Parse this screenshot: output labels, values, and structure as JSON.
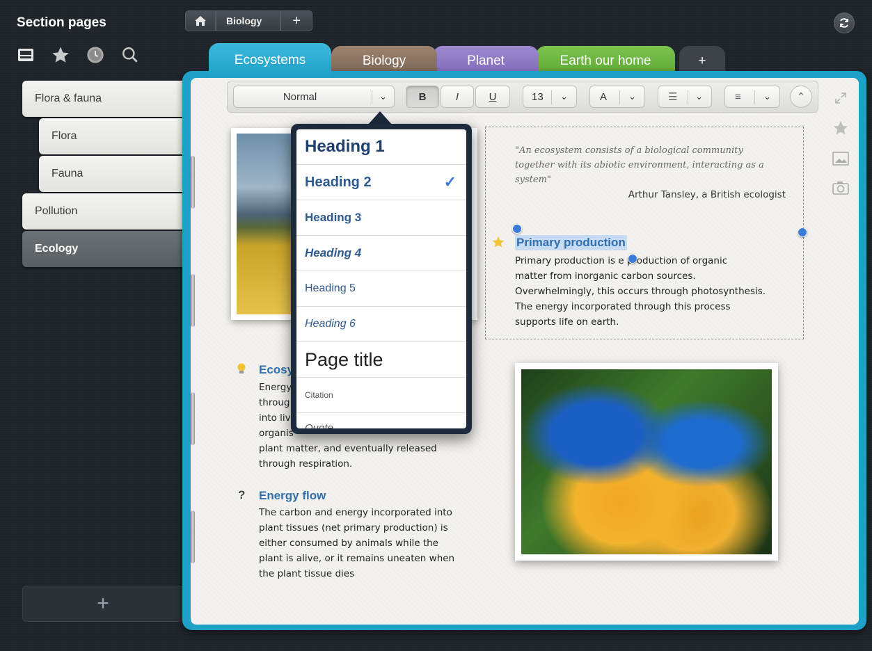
{
  "sidebar": {
    "title": "Section pages",
    "items": [
      {
        "label": "Flora & fauna"
      },
      {
        "label": "Flora"
      },
      {
        "label": "Fauna"
      },
      {
        "label": "Pollution"
      },
      {
        "label": "Ecology"
      }
    ],
    "add_label": "+"
  },
  "breadcrumb": {
    "items": [
      "Biology"
    ],
    "add_label": "+"
  },
  "tabs": [
    {
      "label": "Ecosystems",
      "color": "#2aa7cf"
    },
    {
      "label": "Biology",
      "color": "#8c7461"
    },
    {
      "label": "Planet",
      "color": "#8e78c4"
    },
    {
      "label": "Earth our home",
      "color": "#6ab43c"
    },
    {
      "label": "+",
      "color": "#4a4f55"
    }
  ],
  "toolbar": {
    "style_value": "Normal",
    "bold_label": "B",
    "italic_label": "I",
    "underline_label": "U",
    "font_size": "13",
    "font_label": "A"
  },
  "style_menu": {
    "items": [
      {
        "label": "Heading 1"
      },
      {
        "label": "Heading 2",
        "selected": true,
        "check": "✓"
      },
      {
        "label": "Heading 3"
      },
      {
        "label": "Heading 4"
      },
      {
        "label": "Heading 5"
      },
      {
        "label": "Heading 6"
      },
      {
        "label": "Page title"
      },
      {
        "label": "Citation"
      },
      {
        "label": "Quote"
      }
    ]
  },
  "content": {
    "quote_lines": [
      "\"An ecosystem consists of a biological community",
      "together with its abiotic environment, interacting as a",
      "system\""
    ],
    "quote_author": "Arthur Tansley, a British ecologist",
    "primary_title": "Primary production",
    "primary_body": [
      "Primary production is  e production of organic",
      "matter from inorganic carbon sources.",
      "Overwhelmingly, this occurs through photosynthesis.",
      "The energy incorporated through this process",
      "supports life on earth."
    ],
    "eco_title": "Ecosy",
    "eco_body": [
      "Energy",
      "throug",
      "into liv",
      "organis",
      "plant matter, and eventually released",
      "through respiration."
    ],
    "energy_title": "Energy flow",
    "energy_marker": "?",
    "energy_body": [
      "The carbon and energy incorporated into",
      "plant tissues (net primary production) is",
      "either consumed by animals while the",
      "plant is alive, or it remains uneaten when",
      "the plant tissue dies"
    ]
  },
  "colors": {
    "accent": "#2f6fae",
    "selection_handle": "#3b7bd8",
    "notebook_border": "#1fa0c6"
  }
}
